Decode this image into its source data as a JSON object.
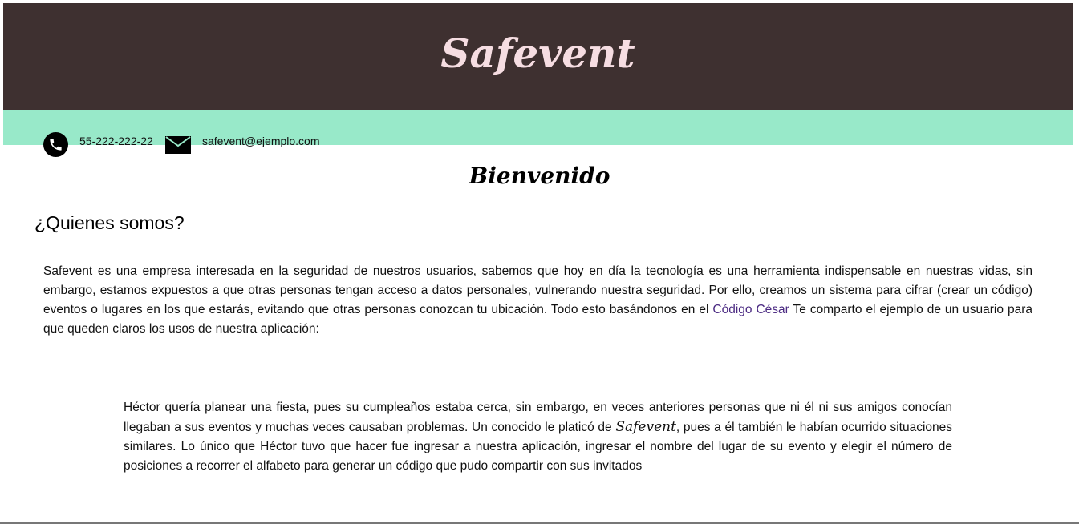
{
  "header": {
    "brand": "Safevent"
  },
  "contact": {
    "phone": "55-222-222-22",
    "email": "safevent@ejemplo.com",
    "phone_icon": "phone-icon",
    "mail_icon": "mail-icon"
  },
  "main": {
    "welcome": "Bienvenido",
    "section_title": "¿Quienes somos?",
    "intro_text": "Safevent es una empresa interesada en la seguridad de nuestros usuarios, sabemos que hoy en día la tecnología es una herramienta indispensable en nuestras vidas, sin embargo, estamos expuestos a que otras personas tengan acceso a datos personales, vulnerando nuestra seguridad. Por ello, creamos un sistema para cifrar (crear un código) eventos o lugares en los que estarás, evitando que otras personas conozcan tu ubicación. Todo esto basándonos en el ",
    "intro_link": "Código César",
    "intro_text_after": " Te comparto el ejemplo de un usuario para que queden claros los usos de nuestra aplicación:",
    "story_text_before": "Héctor quería planear una fiesta, pues su cumpleaños estaba cerca, sin embargo, en veces anteriores personas que ni él ni sus amigos conocían llegaban a sus eventos y muchas veces causaban problemas. Un conocido le platicó de ",
    "story_brand": "Safevent",
    "story_text_after": ", pues a él también le habían ocurrido situaciones similares. Lo único que Héctor tuvo que hacer fue ingresar a nuestra aplicación, ingresar el nombre del lugar de su evento y elegir el número de posiciones a recorrer el alfabeto para generar un código que pudo compartir con sus invitados"
  },
  "colors": {
    "header_bg": "#3e3030",
    "brand_text": "#f6dde2",
    "contact_bar": "#98e9c9",
    "link": "#4b2a82"
  }
}
